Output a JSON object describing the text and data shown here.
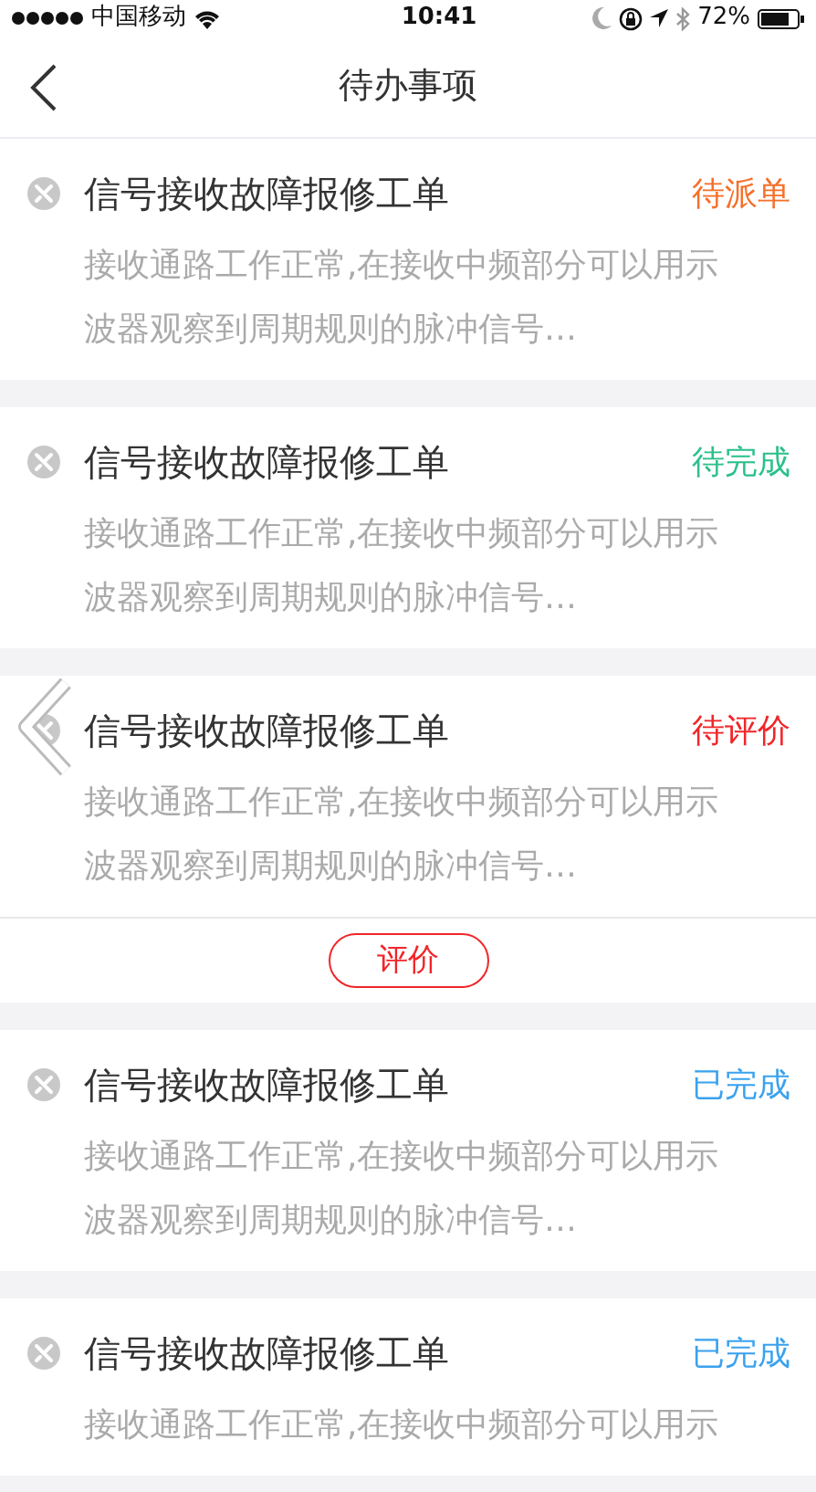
{
  "status_bar": {
    "carrier": "中国移动",
    "time": "10:41",
    "battery_text": "72%"
  },
  "nav": {
    "title": "待办事项"
  },
  "items": [
    {
      "title": "信号接收故障报修工单",
      "status": "待派单",
      "color": "#f5702a",
      "description": "接收通路工作正常,在接收中频部分可以用示波器观察到周期规则的脉冲信号…"
    },
    {
      "title": "信号接收故障报修工单",
      "status": "待完成",
      "color": "#2cc08b",
      "description": "接收通路工作正常,在接收中频部分可以用示波器观察到周期规则的脉冲信号…"
    },
    {
      "title": "信号接收故障报修工单",
      "status": "待评价",
      "color": "#f0262a",
      "description": "接收通路工作正常,在接收中频部分可以用示波器观察到周期规则的脉冲信号…",
      "action": "评价"
    },
    {
      "title": "信号接收故障报修工单",
      "status": "已完成",
      "color": "#3aa2ee",
      "description": "接收通路工作正常,在接收中频部分可以用示波器观察到周期规则的脉冲信号…"
    },
    {
      "title": "信号接收故障报修工单",
      "status": "已完成",
      "color": "#3aa2ee",
      "description": "接收通路工作正常,在接收中频部分可以用示"
    }
  ]
}
